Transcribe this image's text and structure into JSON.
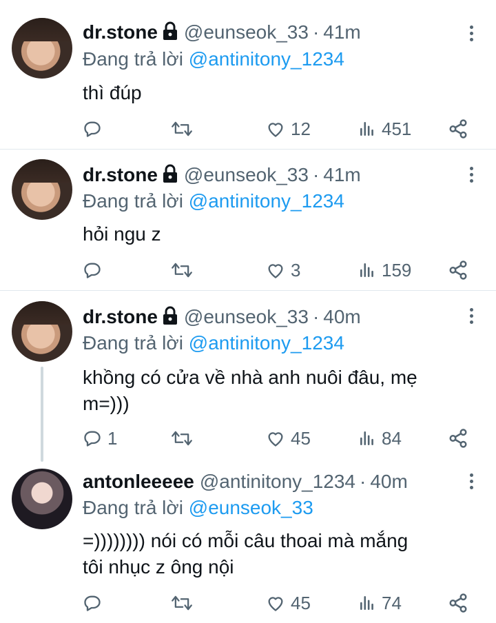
{
  "tweets": [
    {
      "name": "dr.stone",
      "handle": "@eunseok_33",
      "dot": "·",
      "time": "41m",
      "reply_prefix": "Đang trả lời",
      "reply_to": "@antinitony_1234",
      "text": "thì đúp",
      "replies": "",
      "likes": "12",
      "views": "451"
    },
    {
      "name": "dr.stone",
      "handle": "@eunseok_33",
      "dot": "·",
      "time": "41m",
      "reply_prefix": "Đang trả lời",
      "reply_to": "@antinitony_1234",
      "text": "hỏi ngu z",
      "replies": "",
      "likes": "3",
      "views": "159"
    },
    {
      "name": "dr.stone",
      "handle": "@eunseok_33",
      "dot": "·",
      "time": "40m",
      "reply_prefix": "Đang trả lời",
      "reply_to": "@antinitony_1234",
      "text_line1": "khồng có cửa về nhà anh nuôi đâu, mẹ",
      "text_line2": "m=)))",
      "replies": "1",
      "likes": "45",
      "views": "84"
    },
    {
      "name": "antonleeeee",
      "handle": "@antinitony_1234",
      "dot": "·",
      "time": "40m",
      "reply_prefix": "Đang trả lời",
      "reply_to": "@eunseok_33",
      "text_line1": "=)))))))) nói có mỗi câu thoai mà mắng",
      "text_line2": "tôi nhục z ông nội",
      "replies": "",
      "likes": "45",
      "views": "74"
    }
  ],
  "icons": {
    "lock": "lock-icon",
    "reply": "reply-icon",
    "retweet": "retweet-icon",
    "like": "heart-icon",
    "views": "views-icon",
    "share": "share-icon",
    "more": "more-icon"
  },
  "colors": {
    "link": "#1d9bf0",
    "muted": "#536471",
    "text": "#0f1419",
    "divider": "#e1e8ed"
  }
}
